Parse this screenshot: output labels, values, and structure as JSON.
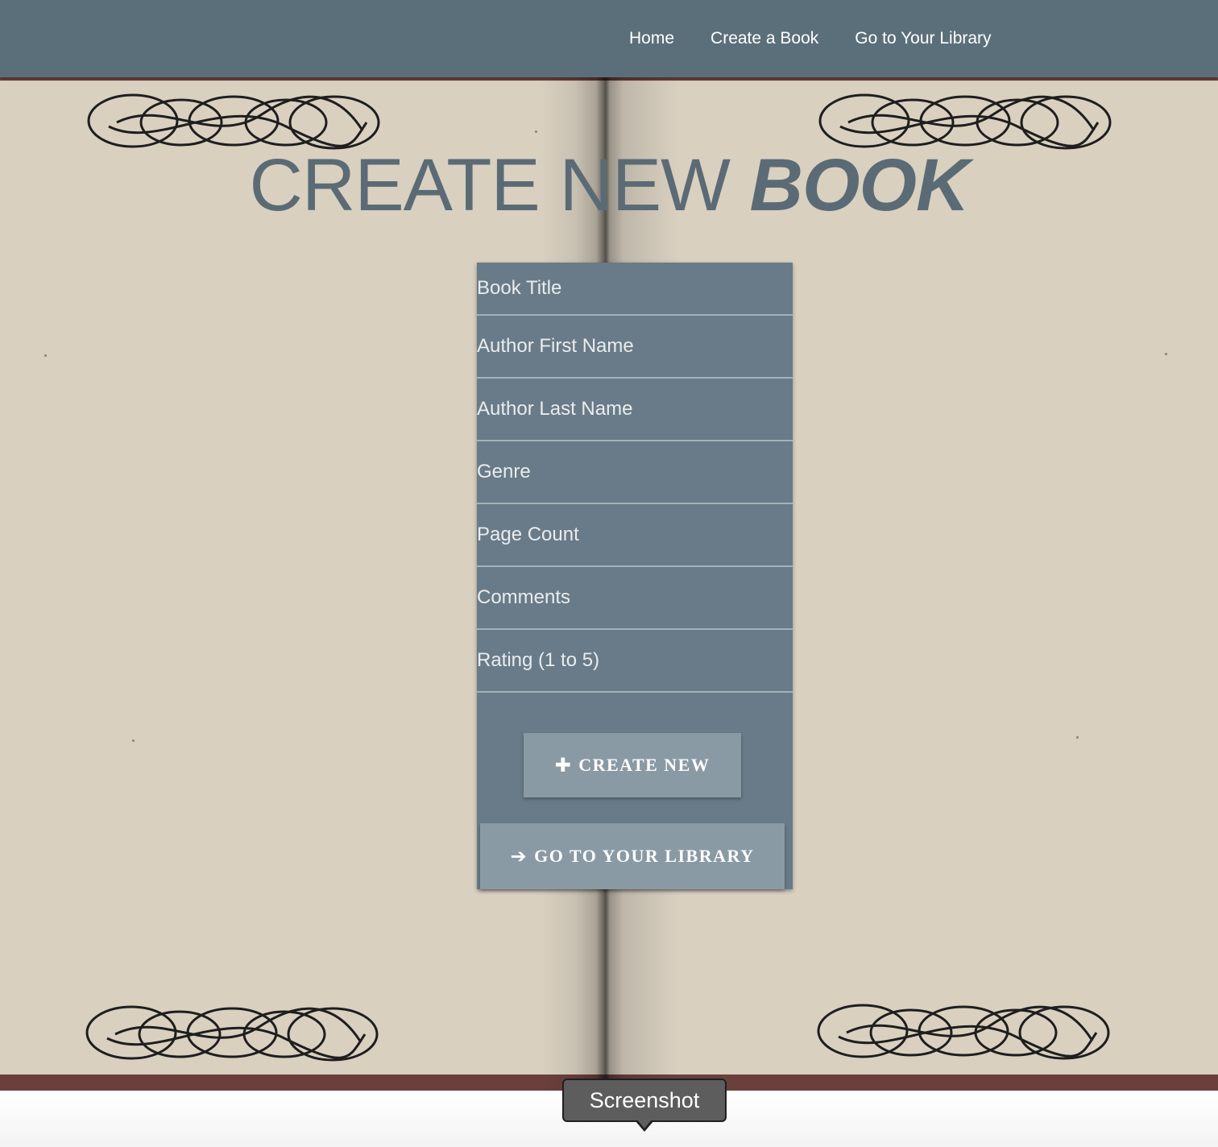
{
  "nav": {
    "links": [
      "Home",
      "Create a Book",
      "Go to Your Library"
    ]
  },
  "page": {
    "title_plain": "CREATE NEW ",
    "title_emphasis": "BOOK"
  },
  "form": {
    "fields": [
      "Book Title",
      "Author First Name",
      "Author Last Name",
      "Genre",
      "Page Count",
      "Comments",
      "Rating (1 to 5)"
    ],
    "create_button": "CREATE NEW",
    "library_button": "GO TO YOUR LIBRARY"
  },
  "tooltip": {
    "text": "Screenshot"
  },
  "colors": {
    "navbar": "#5b6f7b",
    "form_card": "#697b88",
    "button": "#8a9aa5",
    "title": "#5b6b76",
    "page": "#d9d0c0",
    "cover": "#6a3f3c"
  }
}
